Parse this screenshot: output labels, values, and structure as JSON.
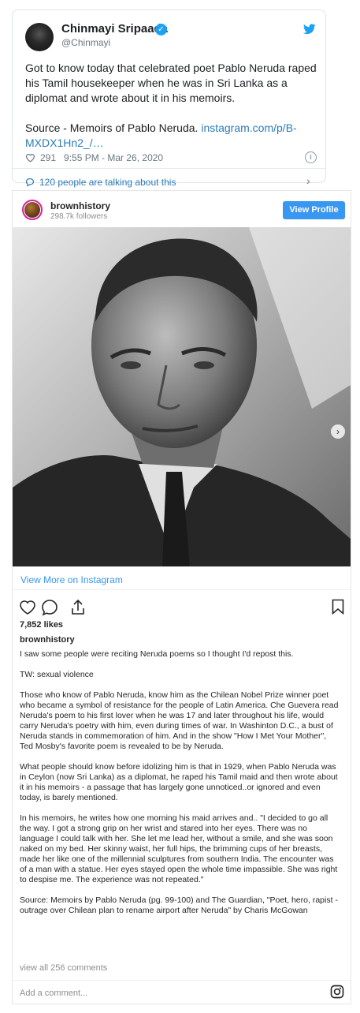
{
  "tweet": {
    "name": "Chinmayi Sripaada",
    "handle": "@Chinmayi",
    "text": "Got to know today that celebrated poet Pablo Neruda raped his Tamil housekeeper when he was in Sri Lanka as a diplomat and wrote about it in his memoirs.\n\nSource - Memoirs of Pablo Neruda. ",
    "link": "instagram.com/p/B-MXDX1Hn2_/…",
    "likes": "291",
    "timestamp": "9:55 PM - Mar 26, 2020",
    "talking": "120 people are talking about this",
    "verified_icon": "verified-check-icon",
    "brand_color": "#1da1f2"
  },
  "instagram": {
    "username": "brownhistory",
    "followers": "298.7k followers",
    "view_profile": "View Profile",
    "view_more": "View More on Instagram",
    "likes": "7,852 likes",
    "caption_user": "brownhistory",
    "caption": "I saw some people were reciting Neruda poems so I thought I'd repost this.\n\nTW: sexual violence\n\nThose who know of Pablo Neruda, know him as the Chilean Nobel Prize winner poet who became a symbol of resistance for the people of Latin America. Che Guevera read Neruda's poem to his first lover when he was 17 and later throughout his life, would carry Neruda's poetry with him, even during times of war. In Washinton D.C., a bust of Neruda stands in commemoration of him. And in the show \"How I Met Your Mother\", Ted Mosby's favorite poem is revealed to be by Neruda.\n\nWhat people should know before idolizing him is that in 1929, when Pablo Neruda was in Ceylon (now Sri Lanka) as a diplomat, he raped his Tamil maid and then wrote about it in his memoirs - a passage that has largely gone unnoticed..or ignored and even today, is barely mentioned.\n\nIn his memoirs, he writes how one morning his maid arrives and.. \"I decided to go all the way. I got a strong grip on her wrist and stared into her eyes. There was no language I could talk with her. She let me lead her, without a smile, and she was soon naked on my bed. Her skinny waist, her full hips, the brimming cups of her breasts, made her like one of the millennial sculptures from southern India. The encounter was of a man with a statue. Her eyes stayed open the whole time impassible. She was right to despise me. The experience was not repeated.\"\n\nSource: Memoirs by Pablo Neruda (pg. 99-100) and The Guardian, \"Poet, hero, rapist - outrage over Chilean plan to rename airport after Neruda\" by Charis McGowan",
    "view_comments": "view all 256 comments",
    "add_comment": "Add a comment...",
    "accent": "#3897f0"
  }
}
